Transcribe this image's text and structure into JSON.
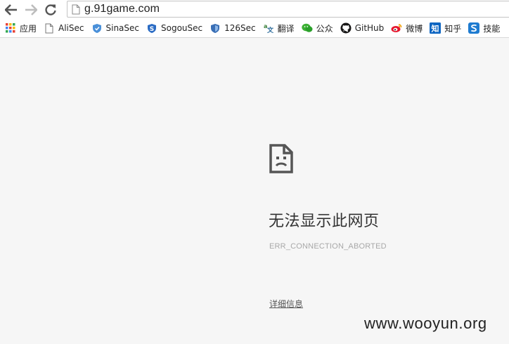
{
  "browser": {
    "url": "g.91game.com",
    "bookmarks": [
      {
        "label": "应用",
        "icon": "apps-grid-icon"
      },
      {
        "label": "AliSec",
        "icon": "page-icon"
      },
      {
        "label": "SinaSec",
        "icon": "shield-icon"
      },
      {
        "label": "SogouSec",
        "icon": "shield-s-icon"
      },
      {
        "label": "126Sec",
        "icon": "shield-blue-icon"
      },
      {
        "label": "翻译",
        "icon": "translate-icon"
      },
      {
        "label": "公众",
        "icon": "wechat-icon"
      },
      {
        "label": "GitHub",
        "icon": "github-icon"
      },
      {
        "label": "微博",
        "icon": "weibo-icon"
      },
      {
        "label": "知乎",
        "icon": "zhihu-icon"
      },
      {
        "label": "技能",
        "icon": "s-logo-icon"
      }
    ]
  },
  "error_page": {
    "title": "无法显示此网页",
    "code": "ERR_CONNECTION_ABORTED",
    "details_label": "详细信息"
  },
  "watermark": "www.wooyun.org"
}
